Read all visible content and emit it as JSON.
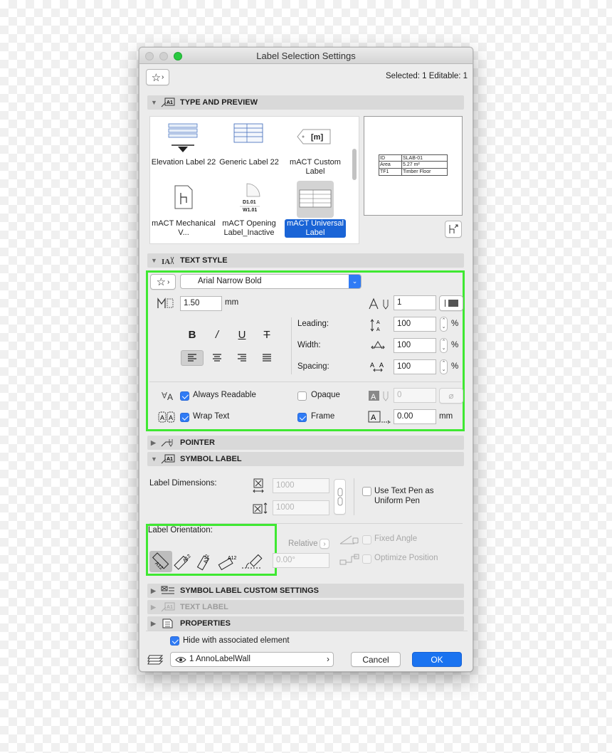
{
  "window": {
    "title": "Label Selection Settings"
  },
  "header": {
    "selection_info": "Selected: 1 Editable: 1"
  },
  "sections": {
    "type_and_preview": "TYPE AND PREVIEW",
    "text_style": "TEXT STYLE",
    "pointer": "POINTER",
    "symbol_label": "SYMBOL LABEL",
    "symbol_label_custom": "SYMBOL LABEL CUSTOM SETTINGS",
    "text_label": "TEXT LABEL",
    "properties": "PROPERTIES"
  },
  "gallery": {
    "items": [
      {
        "label": "Elevation Label 22",
        "selected": false
      },
      {
        "label": "Generic Label 22",
        "selected": false
      },
      {
        "label": "mACT Custom Label",
        "selected": false
      },
      {
        "label": "mACT Mechanical V...",
        "selected": false
      },
      {
        "label": "mACT Opening Label_Inactive",
        "selected": false
      },
      {
        "label": "mACT Universal Label",
        "selected": true
      }
    ],
    "tag_text": "[m]",
    "opening_codes": [
      "D1.01",
      "W1.01"
    ]
  },
  "preview": {
    "rows": [
      {
        "key": "ID",
        "value": "SLAB-01"
      },
      {
        "key": "Area",
        "value": "5.27 m²"
      },
      {
        "key": "TF1",
        "value": "Timber Floor"
      }
    ]
  },
  "text_style": {
    "font_name": "Arial Narrow Bold",
    "size_value": "1.50",
    "size_unit": "mm",
    "pen_value": "1",
    "format": {
      "bold": "B",
      "italic": "/",
      "underline": "U",
      "strike": "T"
    },
    "leading_label": "Leading:",
    "leading_value": "100",
    "width_label": "Width:",
    "width_value": "100",
    "spacing_label": "Spacing:",
    "spacing_value": "100",
    "percent": "%",
    "always_readable_label": "Always Readable",
    "always_readable_checked": true,
    "opaque_label": "Opaque",
    "opaque_checked": false,
    "opaque_pen_value": "0",
    "wrap_text_label": "Wrap Text",
    "wrap_text_checked": true,
    "frame_label": "Frame",
    "frame_checked": true,
    "frame_offset_value": "0.00",
    "frame_offset_unit": "mm"
  },
  "symbol_label": {
    "dimensions_label": "Label Dimensions:",
    "width_value": "1000",
    "height_value": "1000",
    "uniform_pen_label": "Use Text Pen as Uniform Pen",
    "uniform_pen_checked": false,
    "orientation_label": "Label Orientation:",
    "relative_label": "Relative",
    "angle_value": "0.00°",
    "fixed_angle_label": "Fixed Angle",
    "optimize_position_label": "Optimize Position",
    "orient_text": "A12"
  },
  "footer": {
    "hide_label": "Hide with associated element",
    "hide_checked": true,
    "layer_value": "1 AnnoLabelWall",
    "cancel_label": "Cancel",
    "ok_label": "OK"
  },
  "colors": {
    "accent": "#2f7bf5",
    "highlight": "#3fe832",
    "ok_button": "#1a73f0"
  }
}
